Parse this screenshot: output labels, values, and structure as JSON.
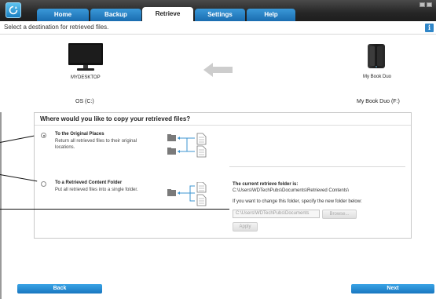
{
  "tabs": [
    {
      "label": "Home",
      "active": false
    },
    {
      "label": "Backup",
      "active": false
    },
    {
      "label": "Retrieve",
      "active": true
    },
    {
      "label": "Settings",
      "active": false
    },
    {
      "label": "Help",
      "active": false
    }
  ],
  "instruction": "Select a destination for retrieved files.",
  "info_icon": "i",
  "devices": {
    "computer_name": "MYDESKTOP",
    "computer_drive": "OS (C:)",
    "external_name": "My Book Duo",
    "external_drive": "My Book Duo (F:)"
  },
  "panel": {
    "heading": "Where would you like to copy your retrieved files?",
    "option1": {
      "title": "To the Original Places",
      "desc_line1": "Return all retrieved files to their original",
      "desc_line2": "locations.",
      "selected": true
    },
    "option2": {
      "title": "To a Retrieved Content Folder",
      "desc": "Put all retrieved files into a single folder.",
      "selected": false
    },
    "retrieve_folder": {
      "label": "The current retrieve folder is:",
      "path": "C:\\Users\\WDTechPubs\\Documents\\Retrieved Contents\\",
      "change_hint": "If you want to change this folder, specify the new folder below:",
      "input_value": "C:\\Users\\WDTechPubs\\Documents",
      "browse_label": "Browse...",
      "apply_label": "Apply"
    }
  },
  "footer": {
    "back_label": "Back",
    "next_label": "Next"
  },
  "colors": {
    "accent_blue": "#1a78c2",
    "tab_blue": "#2a87cf",
    "titlebar": "#2a2a2a",
    "arrow_gray": "#c8c8c8",
    "connector_blue": "#3c94d0"
  }
}
